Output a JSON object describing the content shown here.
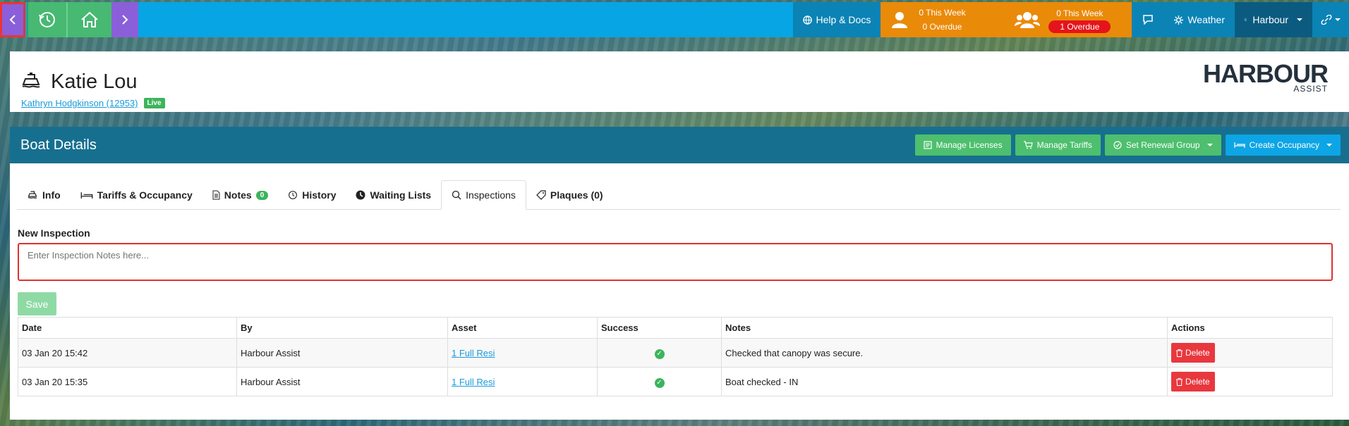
{
  "topbar": {
    "help_label": "Help & Docs",
    "personal": {
      "this_week": "0 This Week",
      "overdue": "0 Overdue"
    },
    "team": {
      "this_week": "0 This Week",
      "overdue": "1 Overdue"
    },
    "weather_label": "Weather",
    "harbour_label": "Harbour"
  },
  "boat": {
    "name": "Katie Lou",
    "owner_link": "Kathryn Hodgkinson (12953)",
    "status_badge": "Live"
  },
  "logo": {
    "main": "HARBOUR",
    "sub": "ASSIST"
  },
  "panel": {
    "title": "Boat Details",
    "buttons": {
      "manage_licenses": "Manage Licenses",
      "manage_tariffs": "Manage Tariffs",
      "set_renewal_group": "Set Renewal Group",
      "create_occupancy": "Create Occupancy"
    },
    "tabs": {
      "info": "Info",
      "tariffs": "Tariffs & Occupancy",
      "notes": "Notes",
      "notes_count": "0",
      "history": "History",
      "waiting": "Waiting Lists",
      "inspections": "Inspections",
      "plaques": "Plaques (0)"
    },
    "new_inspection_label": "New Inspection",
    "notes_placeholder": "Enter Inspection Notes here...",
    "save_label": "Save"
  },
  "table": {
    "headers": {
      "date": "Date",
      "by": "By",
      "asset": "Asset",
      "success": "Success",
      "notes": "Notes",
      "actions": "Actions"
    },
    "rows": [
      {
        "date": "03 Jan 20 15:42",
        "by": "Harbour Assist",
        "asset": "1 Full Resi",
        "notes": "Checked that canopy was secure.",
        "action": "Delete"
      },
      {
        "date": "03 Jan 20 15:35",
        "by": "Harbour Assist",
        "asset": "1 Full Resi",
        "notes": "Boat checked - IN",
        "action": "Delete"
      }
    ]
  },
  "colors": {
    "accent": "#07a5e4",
    "orange": "#ea8a09",
    "panel_header": "#176f8f",
    "green": "#4dbf6e",
    "danger": "#e8383e"
  }
}
